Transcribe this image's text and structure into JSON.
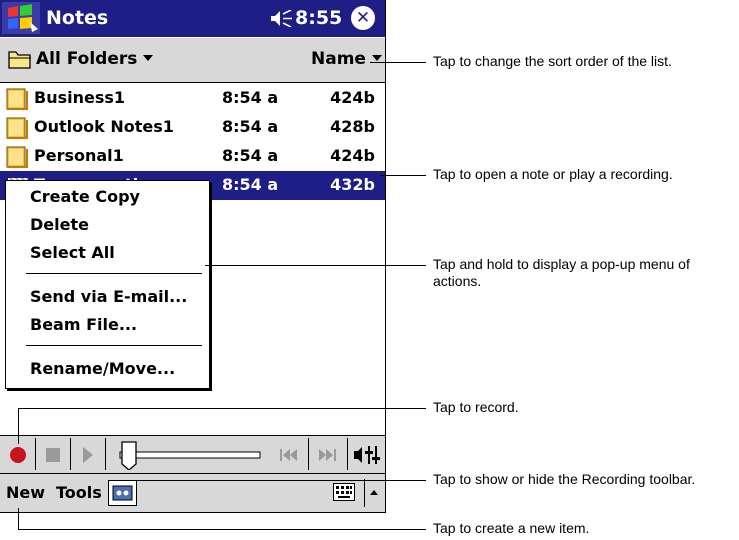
{
  "titlebar": {
    "app_title": "Notes",
    "clock": "8:55",
    "close_glyph": "✕"
  },
  "folder_bar": {
    "folder_label": "All Folders",
    "sort_label": "Name"
  },
  "notes": [
    {
      "name": "Business1",
      "time": "8:54 a",
      "size": "424b"
    },
    {
      "name": "Outlook Notes1",
      "time": "8:54 a",
      "size": "428b"
    },
    {
      "name": "Personal1",
      "time": "8:54 a",
      "size": "424b"
    },
    {
      "name": "Team meeting no...",
      "time": "8:54 a",
      "size": "432b"
    }
  ],
  "popup_menu": {
    "create_copy": "Create Copy",
    "delete": "Delete",
    "select_all": "Select All",
    "send_email": "Send via E-mail...",
    "beam_file": "Beam File...",
    "rename_move": "Rename/Move..."
  },
  "menu_bar": {
    "new": "New",
    "tools": "Tools"
  },
  "callouts": {
    "sort": "Tap to change the sort order of the list.",
    "open": "Tap to open a note or play a recording.",
    "hold": "Tap and hold to display a pop-up menu of actions.",
    "record": "Tap to record.",
    "toolbar": "Tap to show or hide the Recording toolbar.",
    "new_item": "Tap to create a new item."
  },
  "colors": {
    "titlebar": "#1f1d86",
    "selection": "#1f1d86",
    "toolbar_gray": "#d9d8d8",
    "record_red": "#c8141e",
    "folder_yellow": "#f2c200"
  }
}
